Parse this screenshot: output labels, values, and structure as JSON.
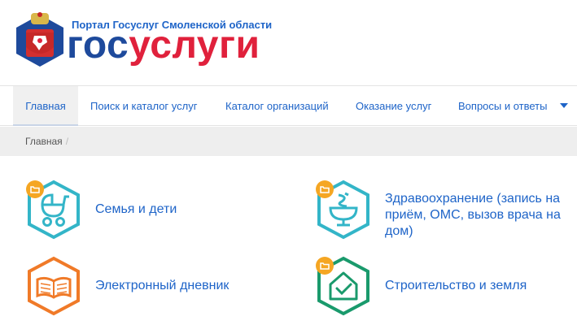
{
  "header": {
    "portal_subtitle": "Портал Госуслуг Смоленской области",
    "brand_gos": "гос",
    "brand_uslugi": "услуги",
    "brand_color_gos": "#1e4a9c",
    "brand_color_uslugi": "#e0213c"
  },
  "nav": {
    "items": [
      {
        "label": "Главная",
        "active": true
      },
      {
        "label": "Поиск и каталог услуг"
      },
      {
        "label": "Каталог организаций"
      },
      {
        "label": "Оказание услуг"
      },
      {
        "label": "Вопросы и ответы"
      }
    ],
    "accent": "#1e64c8"
  },
  "breadcrumb": {
    "items": [
      "Главная"
    ],
    "separator": "/"
  },
  "categories": [
    {
      "label": "Семья и дети",
      "icon": "baby-stroller-icon",
      "color": "#33b5c8"
    },
    {
      "label": "Здравоохранение (запись на приём, ОМС, вызов врача на дом)",
      "icon": "medicine-bowl-icon",
      "color": "#33b5c8"
    },
    {
      "label": "Электронный дневник",
      "icon": "open-book-icon",
      "color": "#f07a28"
    },
    {
      "label": "Строительство и земля",
      "icon": "house-check-icon",
      "color": "#1a9a6c"
    }
  ],
  "folder_badge": {
    "icon": "folder-icon",
    "color": "#f5a623"
  }
}
